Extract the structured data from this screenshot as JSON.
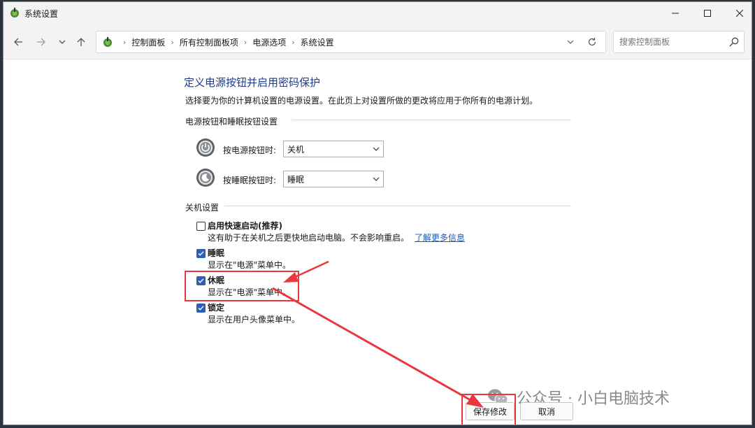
{
  "window": {
    "title": "系统设置"
  },
  "nav": {
    "breadcrumbs": [
      "控制面板",
      "所有控制面板项",
      "电源选项",
      "系统设置"
    ],
    "search_placeholder": "搜索控制面板"
  },
  "page": {
    "title": "定义电源按钮并启用密码保护",
    "description": "选择要为你的计算机设置的电源设置。在此页上对设置所做的更改将应用于你所有的电源计划。"
  },
  "power_buttons": {
    "section_title": "电源按钮和睡眠按钮设置",
    "items": [
      {
        "label": "按电源按钮时:",
        "value": "关机",
        "icon": "power-button-icon"
      },
      {
        "label": "按睡眠按钮时:",
        "value": "睡眠",
        "icon": "sleep-button-icon"
      }
    ]
  },
  "shutdown": {
    "section_title": "关机设置",
    "options": [
      {
        "title": "启用快速启动(推荐)",
        "desc": "这有助于在关机之后更快地启动电脑。不会影响重启。",
        "link": "了解更多信息",
        "checked": false
      },
      {
        "title": "睡眠",
        "desc": "显示在\"电源\"菜单中。",
        "checked": true
      },
      {
        "title": "休眠",
        "desc": "显示在\"电源\"菜单中。",
        "checked": true
      },
      {
        "title": "锁定",
        "desc": "显示在用户头像菜单中。",
        "checked": true
      }
    ]
  },
  "buttons": {
    "save": "保存修改",
    "cancel": "取消"
  },
  "watermark": {
    "text": "公众号 · 小白电脑技术"
  },
  "colors": {
    "accent": "#2f5fb5",
    "title_blue": "#1e3b8a",
    "annotation_red": "#e8383d"
  }
}
